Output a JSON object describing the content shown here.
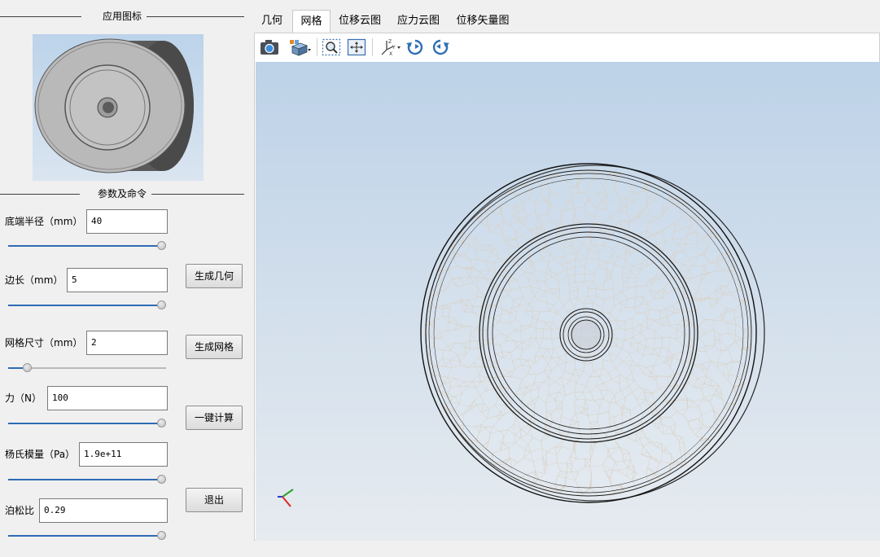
{
  "left_panel": {
    "icon_group_title": "应用图标",
    "params_group_title": "参数及命令",
    "params": [
      {
        "label": "底端半径（mm）",
        "value": "40",
        "slider_fraction": 1.0
      },
      {
        "label": "边长（mm）",
        "value": "5",
        "slider_fraction": 1.0
      },
      {
        "label": "网格尺寸（mm）",
        "value": "2",
        "slider_fraction": 0.1
      },
      {
        "label": "力（N）",
        "value": "100",
        "slider_fraction": 1.0
      },
      {
        "label": "杨氏模量（Pa）",
        "value": "1.9e+11",
        "slider_fraction": 1.0
      },
      {
        "label": "泊松比",
        "value": "0.29",
        "slider_fraction": 1.0
      }
    ],
    "buttons": {
      "generate_geometry": "生成几何",
      "generate_mesh": "生成网格",
      "compute": "一键计算",
      "exit": "退出"
    }
  },
  "tabs": [
    {
      "label": "几何",
      "active": false
    },
    {
      "label": "网格",
      "active": true
    },
    {
      "label": "位移云图",
      "active": false
    },
    {
      "label": "应力云图",
      "active": false
    },
    {
      "label": "位移矢量图",
      "active": false
    }
  ],
  "toolbar": {
    "icons": [
      "camera-icon",
      "view-cube-icon",
      "zoom-fit-icon",
      "pan-icon",
      "axes-view-icon",
      "rotate-left-icon",
      "rotate-right-icon"
    ]
  },
  "colors": {
    "slider_fill": "#2e6bb5",
    "viewer_bg_top": "#bdd2e8",
    "viewer_bg_bottom": "#e6ebf0",
    "mesh_line": "#000000",
    "axis_x": "#e0261f",
    "axis_y": "#2aa52a",
    "axis_z": "#2a36d8"
  }
}
